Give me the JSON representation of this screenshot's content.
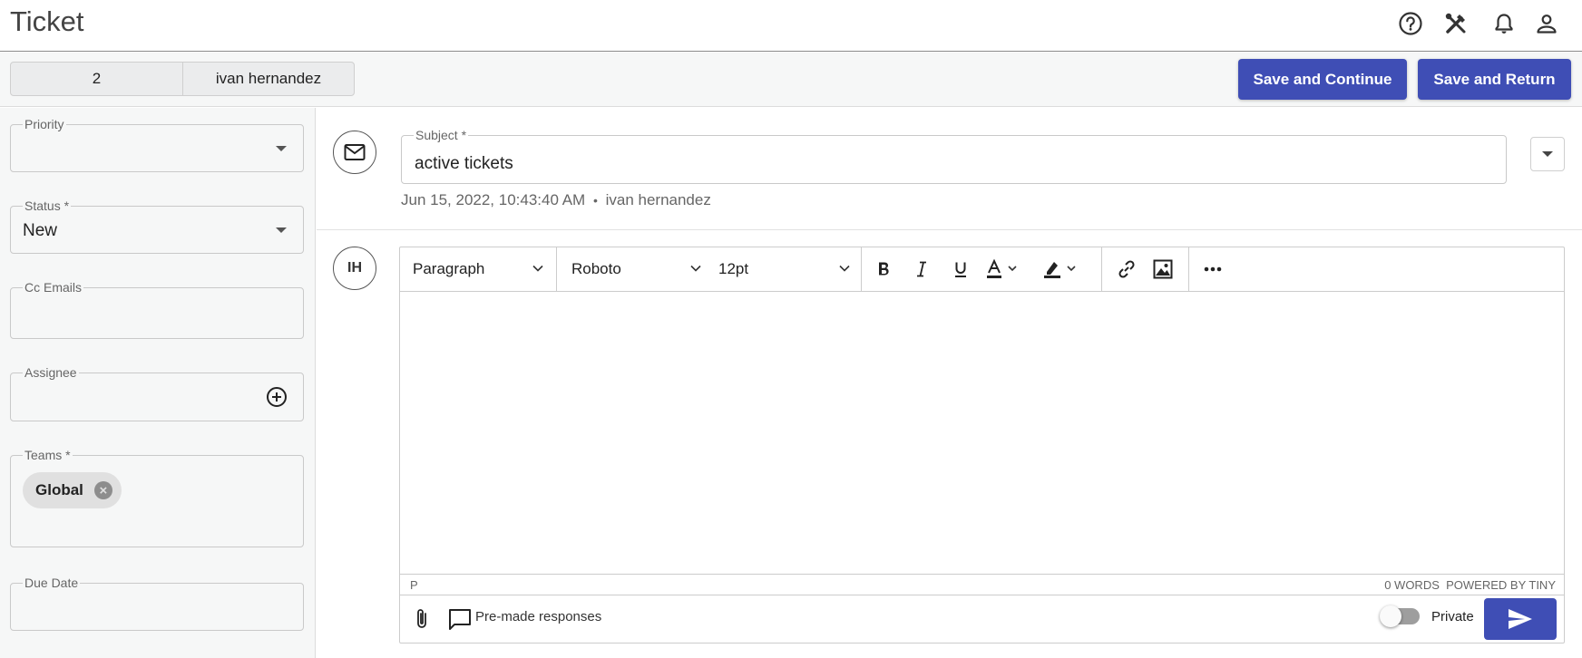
{
  "header": {
    "title": "Ticket",
    "icons": [
      "help-icon",
      "tools-icon",
      "bell-icon",
      "account-icon"
    ]
  },
  "subbar": {
    "ticket_number": "2",
    "requester": "ivan hernandez",
    "save_continue_label": "Save and Continue",
    "save_return_label": "Save and Return"
  },
  "sidebar": {
    "priority_label": "Priority",
    "priority_value": "",
    "status_label": "Status *",
    "status_value": "New",
    "cc_label": "Cc Emails",
    "assignee_label": "Assignee",
    "teams_label": "Teams *",
    "teams": [
      "Global"
    ],
    "due_date_label": "Due Date"
  },
  "ticket": {
    "subject_label": "Subject *",
    "subject_value": "active tickets",
    "date": "Jun 15, 2022, 10:43:40 AM",
    "separator": "•",
    "author": "ivan hernandez"
  },
  "reply": {
    "avatar_initials": "IH",
    "block_format": "Paragraph",
    "font_family": "Roboto",
    "font_size": "12pt",
    "status_path": "P",
    "word_count": "0 WORDS",
    "powered_by": "POWERED BY TINY",
    "premade_label": "Pre-made responses",
    "private_label": "Private",
    "private_on": false
  },
  "colors": {
    "primary": "#3f4eb5",
    "sidebar_bg": "#f6f7f7",
    "border": "#c9c9c9"
  }
}
